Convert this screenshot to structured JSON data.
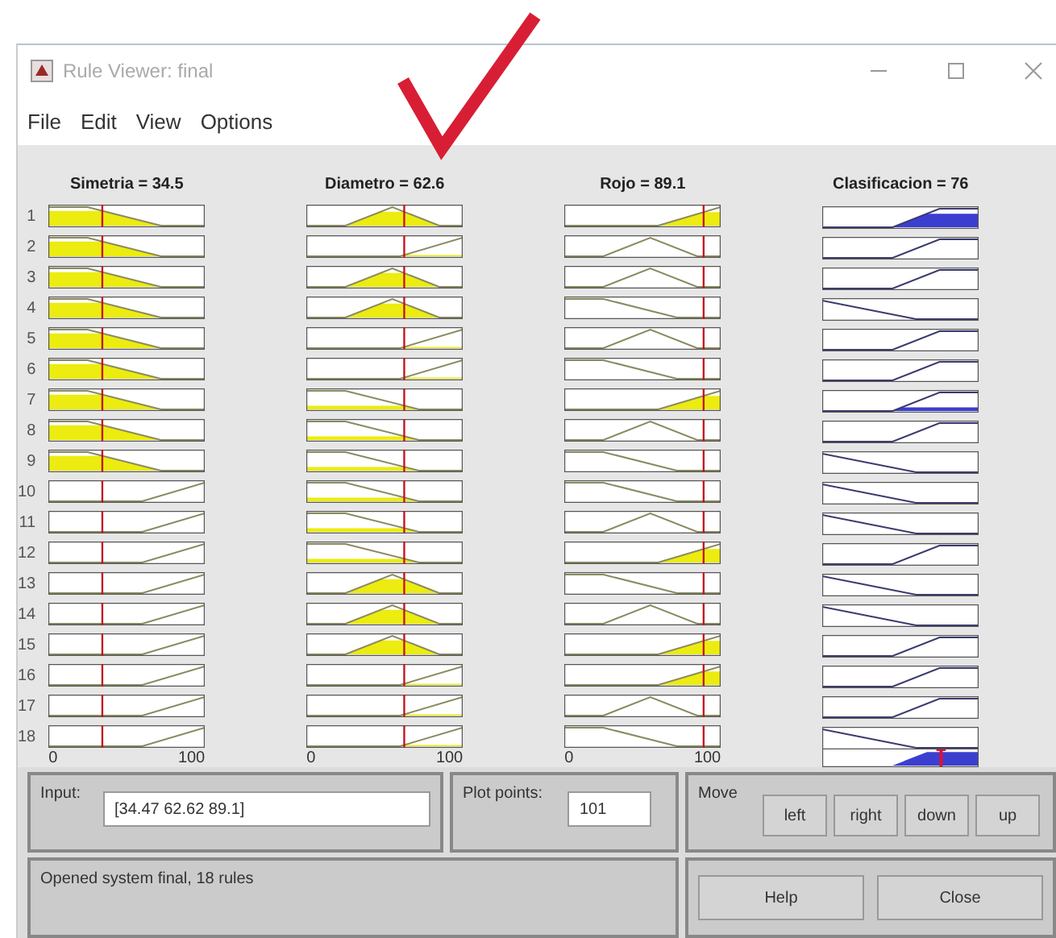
{
  "window": {
    "title": "Rule Viewer: final"
  },
  "menu": [
    "File",
    "Edit",
    "View",
    "Options"
  ],
  "variables": [
    {
      "label": "Simetria = 34.5",
      "kind": "input",
      "level": 0.345,
      "axis_min": "0",
      "axis_max": "100"
    },
    {
      "label": "Diametro = 62.6",
      "kind": "input",
      "level": 0.626,
      "axis_min": "0",
      "axis_max": "100"
    },
    {
      "label": "Rojo = 89.1",
      "kind": "input",
      "level": 0.891,
      "axis_min": "0",
      "axis_max": "100"
    },
    {
      "label": "Clasificacion = 76",
      "kind": "output",
      "level": 0.76
    }
  ],
  "rules": [
    {
      "number": "1",
      "mfs": [
        {
          "kind": "low"
        },
        {
          "kind": "mid"
        },
        {
          "kind": "high"
        },
        {
          "kind": "high"
        }
      ]
    },
    {
      "number": "2",
      "mfs": [
        {
          "kind": "low"
        },
        {
          "kind": "high"
        },
        {
          "kind": "mid"
        },
        {
          "kind": "high"
        }
      ]
    },
    {
      "number": "3",
      "mfs": [
        {
          "kind": "low"
        },
        {
          "kind": "mid"
        },
        {
          "kind": "mid"
        },
        {
          "kind": "high"
        }
      ]
    },
    {
      "number": "4",
      "mfs": [
        {
          "kind": "low"
        },
        {
          "kind": "mid"
        },
        {
          "kind": "low"
        },
        {
          "kind": "low"
        }
      ]
    },
    {
      "number": "5",
      "mfs": [
        {
          "kind": "low"
        },
        {
          "kind": "high"
        },
        {
          "kind": "mid"
        },
        {
          "kind": "high"
        }
      ]
    },
    {
      "number": "6",
      "mfs": [
        {
          "kind": "low"
        },
        {
          "kind": "high"
        },
        {
          "kind": "low"
        },
        {
          "kind": "high"
        }
      ]
    },
    {
      "number": "7",
      "mfs": [
        {
          "kind": "low"
        },
        {
          "kind": "low"
        },
        {
          "kind": "high"
        },
        {
          "kind": "high"
        }
      ]
    },
    {
      "number": "8",
      "mfs": [
        {
          "kind": "low"
        },
        {
          "kind": "low"
        },
        {
          "kind": "mid"
        },
        {
          "kind": "high"
        }
      ]
    },
    {
      "number": "9",
      "mfs": [
        {
          "kind": "low"
        },
        {
          "kind": "low"
        },
        {
          "kind": "low"
        },
        {
          "kind": "low"
        }
      ]
    },
    {
      "number": "10",
      "mfs": [
        {
          "kind": "high"
        },
        {
          "kind": "low"
        },
        {
          "kind": "low"
        },
        {
          "kind": "low"
        }
      ]
    },
    {
      "number": "11",
      "mfs": [
        {
          "kind": "high"
        },
        {
          "kind": "low"
        },
        {
          "kind": "mid"
        },
        {
          "kind": "low"
        }
      ]
    },
    {
      "number": "12",
      "mfs": [
        {
          "kind": "high"
        },
        {
          "kind": "low"
        },
        {
          "kind": "high"
        },
        {
          "kind": "high"
        }
      ]
    },
    {
      "number": "13",
      "mfs": [
        {
          "kind": "high"
        },
        {
          "kind": "mid"
        },
        {
          "kind": "low"
        },
        {
          "kind": "low"
        }
      ]
    },
    {
      "number": "14",
      "mfs": [
        {
          "kind": "high"
        },
        {
          "kind": "mid"
        },
        {
          "kind": "mid"
        },
        {
          "kind": "low"
        }
      ]
    },
    {
      "number": "15",
      "mfs": [
        {
          "kind": "high"
        },
        {
          "kind": "mid"
        },
        {
          "kind": "high"
        },
        {
          "kind": "high"
        }
      ]
    },
    {
      "number": "16",
      "mfs": [
        {
          "kind": "high"
        },
        {
          "kind": "high"
        },
        {
          "kind": "high"
        },
        {
          "kind": "high"
        }
      ]
    },
    {
      "number": "17",
      "mfs": [
        {
          "kind": "high"
        },
        {
          "kind": "high"
        },
        {
          "kind": "mid"
        },
        {
          "kind": "high"
        }
      ]
    },
    {
      "number": "18",
      "mfs": [
        {
          "kind": "high"
        },
        {
          "kind": "high"
        },
        {
          "kind": "low"
        },
        {
          "kind": "low"
        }
      ]
    }
  ],
  "input": {
    "label": "Input:",
    "value": "[34.47 62.62 89.1]"
  },
  "plot_points": {
    "label": "Plot points:",
    "value": "101"
  },
  "move": {
    "label": "Move",
    "buttons": [
      "left",
      "right",
      "down",
      "up"
    ]
  },
  "status": "Opened system final, 18 rules",
  "buttons": [
    "Help",
    "Close"
  ]
}
